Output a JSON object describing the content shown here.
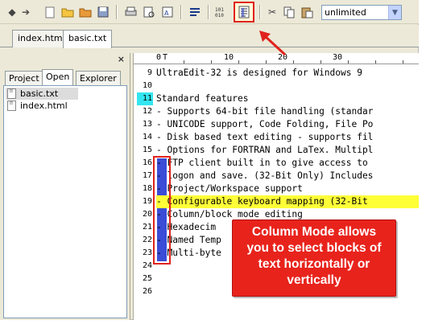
{
  "toolbar": {
    "icons": [
      "back-icon",
      "forward-icon",
      "new-file-icon",
      "open-file-icon",
      "close-file-icon",
      "save-icon",
      "print-icon",
      "print-preview-icon",
      "spell-check-icon",
      "wrap-icon",
      "hex-mode-icon",
      "column-mode-icon",
      "cut-icon",
      "copy-icon",
      "paste-icon"
    ],
    "find_value": "unlimited"
  },
  "doc_tabs": [
    "index.html",
    "basic.txt"
  ],
  "panel": {
    "close_glyph": "×",
    "tabs": [
      "Project",
      "Open",
      "Explorer"
    ],
    "files": [
      "basic.txt",
      "index.html"
    ]
  },
  "editor": {
    "ruler_marks": [
      "0",
      "T",
      "10",
      "20",
      "30"
    ],
    "lines": [
      {
        "num": "9",
        "text": "UltraEdit-32 is designed for Windows 9"
      },
      {
        "num": "10",
        "text": ""
      },
      {
        "num": "11",
        "text": "Standard features"
      },
      {
        "num": "12",
        "text": "- Supports 64-bit file handling (standar"
      },
      {
        "num": "13",
        "text": "- UNICODE support, Code Folding, File Po"
      },
      {
        "num": "14",
        "text": "- Disk based text editing - supports fil"
      },
      {
        "num": "15",
        "text": "- Options for FORTRAN and LaTex. Multipl"
      },
      {
        "num": "16",
        "text": "- FTP client built in to give access to"
      },
      {
        "num": "17",
        "text": "- logon and save. (32-Bit Only) Includes"
      },
      {
        "num": "18",
        "text": "- Project/Workspace support"
      },
      {
        "num": "19",
        "text": "- Configurable keyboard mapping (32-Bit"
      },
      {
        "num": "20",
        "text": "- Column/block mode editing"
      },
      {
        "num": "21",
        "text": "- Hexadecim"
      },
      {
        "num": "22",
        "text": "- Named Temp"
      },
      {
        "num": "23",
        "text": "- Multi-byte"
      },
      {
        "num": "24",
        "text": ""
      },
      {
        "num": "25",
        "text": ""
      },
      {
        "num": "26",
        "text": ""
      }
    ]
  },
  "callout": {
    "line1": "Column Mode allows",
    "line2": "you to select blocks of",
    "line3": "text horizontally or",
    "line4": "vertically"
  },
  "colors": {
    "highlight_line": "#ffff38",
    "column_selection": "#3b4cd6",
    "current_line_number": "#33e5f0",
    "callout": "#e8231c"
  }
}
